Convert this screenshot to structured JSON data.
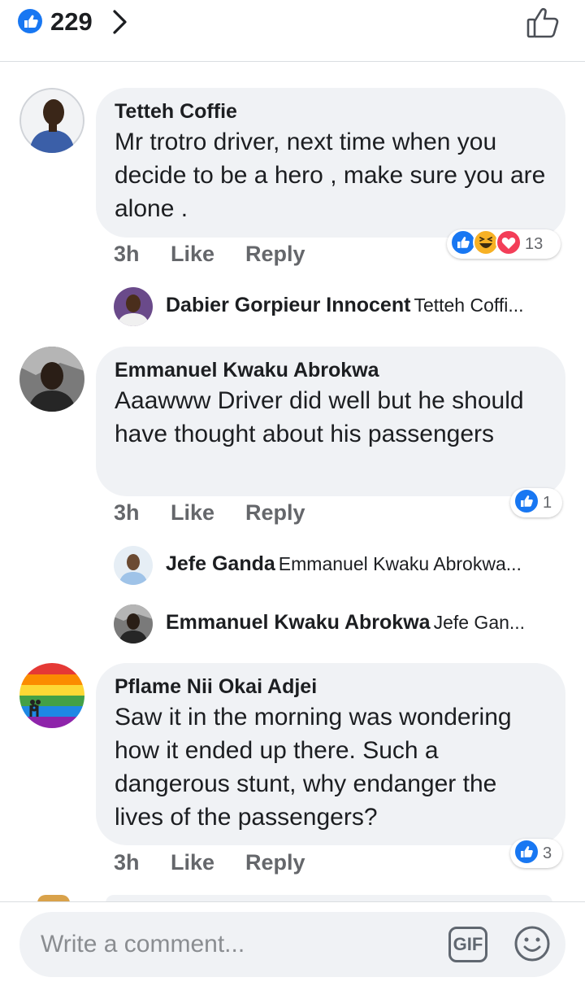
{
  "header": {
    "reaction_count": "229",
    "like_icon": "thumbs-up-badge-icon",
    "chevron_icon": "chevron-right-icon",
    "action_icon": "thumbs-up-outline-icon"
  },
  "comments": [
    {
      "author": "Tetteh Coffie",
      "text": "Mr trotro driver, next time when you decide to be a hero , make sure you are alone .",
      "time": "3h",
      "like_label": "Like",
      "reply_label": "Reply",
      "reactions": [
        "like",
        "haha",
        "love"
      ],
      "reaction_count": "13",
      "replies": [
        {
          "author": "Dabier Gorpieur Innocent",
          "snippet": "Tetteh Coffi..."
        }
      ]
    },
    {
      "author": "Emmanuel Kwaku Abrokwa",
      "text": "Aaawww Driver did well but he should have thought about his passengers",
      "time": "3h",
      "like_label": "Like",
      "reply_label": "Reply",
      "reactions": [
        "like"
      ],
      "reaction_count": "1",
      "replies": [
        {
          "author": "Jefe Ganda",
          "snippet": "Emmanuel Kwaku Abrokwa..."
        },
        {
          "author": "Emmanuel Kwaku Abrokwa",
          "snippet": "Jefe Gan..."
        }
      ]
    },
    {
      "author": "Pflame Nii Okai Adjei",
      "text": "Saw it in the morning was wondering how it ended up there. Such a dangerous stunt, why endanger the lives of the passengers?",
      "time": "3h",
      "like_label": "Like",
      "reply_label": "Reply",
      "reactions": [
        "like"
      ],
      "reaction_count": "3",
      "replies": []
    }
  ],
  "composer": {
    "placeholder": "Write a comment...",
    "gif_label": "GIF",
    "emoji_icon": "smiley-icon"
  },
  "colors": {
    "facebook_blue": "#1877f2",
    "bubble_bg": "#f0f2f5",
    "love_red": "#f33e58",
    "haha_yellow": "#f7b125",
    "secondary_text": "#65676b"
  }
}
